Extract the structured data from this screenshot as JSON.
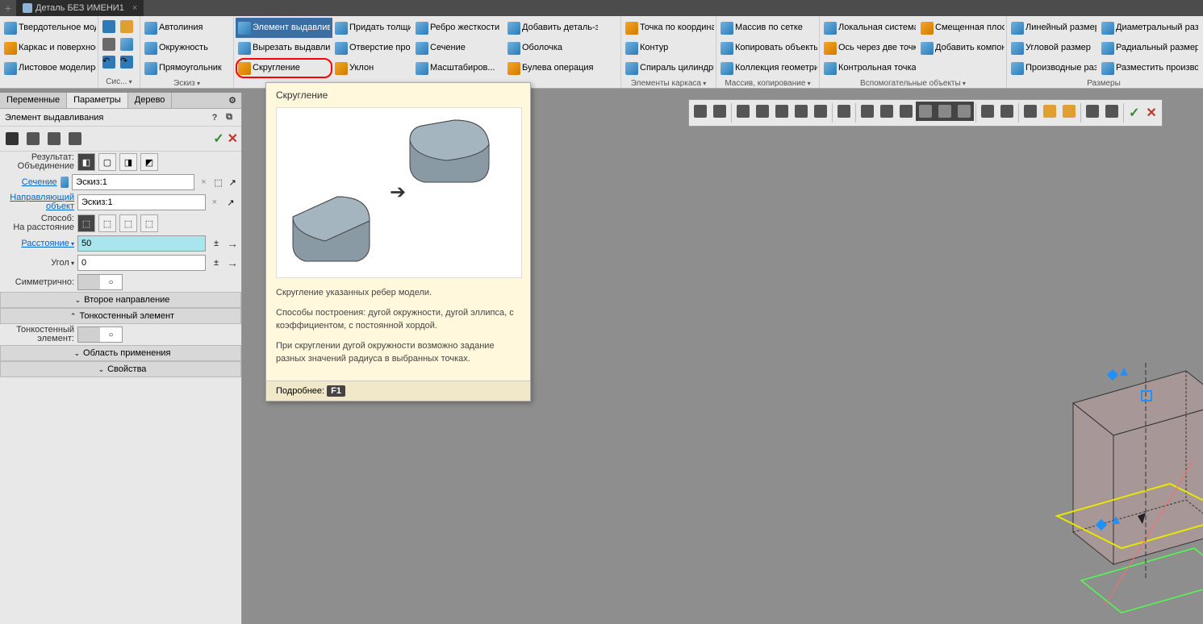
{
  "window": {
    "tab_title": "Деталь БЕЗ ИМЕНИ1"
  },
  "ribbon": {
    "g1": {
      "items": [
        "Твердотельное моделирование",
        "Каркас и поверхности",
        "Листовое моделирование"
      ]
    },
    "g2": {
      "title": "Сис..."
    },
    "g3": {
      "title": "Эскиз",
      "items": [
        "Автолиния",
        "Окружность",
        "Прямоугольник"
      ]
    },
    "g4": {
      "items": [
        "Элемент выдавливания",
        "Вырезать выдавливанием",
        "Скругление",
        "Придать толщину",
        "Отверстие простое",
        "Уклон",
        "Ребро жесткости",
        "Сечение",
        "Масштабиров...",
        "Добавить деталь-загото...",
        "Оболочка",
        "Булева операция"
      ]
    },
    "g5": {
      "title": "Элементы каркаса",
      "items": [
        "Точка по координатам",
        "Контур",
        "Спираль цилиндрическ..."
      ]
    },
    "g6": {
      "title": "Массив, копирование",
      "items": [
        "Массив по сетке",
        "Копировать объекты",
        "Коллекция геометрии"
      ]
    },
    "g7": {
      "title": "Вспомогательные объекты",
      "items": [
        "Локальная система коорд...",
        "Ось через две точки",
        "Контрольная точка",
        "Смещенная плоскость",
        "Добавить компоновочн..."
      ]
    },
    "g8": {
      "title": "Размеры",
      "items": [
        "Линейный размер",
        "Угловой размер",
        "Производные размеры",
        "Диаметральный размер",
        "Радиальный размер",
        "Разместить производные..."
      ]
    }
  },
  "panel": {
    "tabs": [
      "Переменные",
      "Параметры",
      "Дерево"
    ],
    "active_tab": 1,
    "header_title": "Элемент выдавливания",
    "rows": {
      "result_label": "Результат:",
      "union_label": "Объединение",
      "section_label": "Сечение",
      "section_value": "Эскиз:1",
      "guide_label": "Направляющий объект",
      "guide_value": "Эскиз:1",
      "method_label": "Способ:",
      "method_sub": "На расстояние",
      "distance_label": "Расстояние",
      "distance_value": "50",
      "angle_label": "Угол",
      "angle_value": "0",
      "symmetric_label": "Симметрично:"
    },
    "sections": [
      "Второе направление",
      "Тонкостенный элемент",
      "Область применения",
      "Свойства"
    ],
    "thin_label": "Тонкостенный элемент:"
  },
  "tooltip": {
    "title": "Скругление",
    "p1": "Скругление указанных ребер модели.",
    "p2": "Способы построения: дугой окружности, дугой эллипса, с коэффициентом, с постоянной хордой.",
    "p3": "При скруглении дугой окружности возможно задание разных значений радиуса в выбранных точках.",
    "more": "Подробнее:",
    "key": "F1"
  }
}
